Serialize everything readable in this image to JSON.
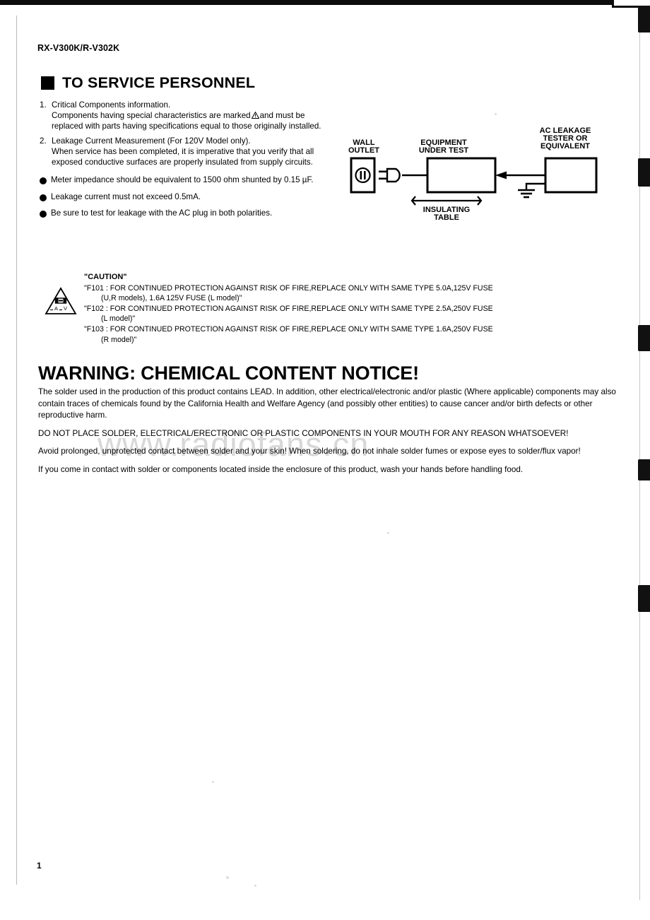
{
  "document": {
    "model_line": "RX-V300K/R-V302K",
    "page_number": "1",
    "watermark": "www.radiofans.cn"
  },
  "service_section": {
    "heading": "TO SERVICE PERSONNEL",
    "numbered_items": [
      {
        "number": "1.",
        "line1": "Critical Components information.",
        "line2_a": "Components having special characteristics are marked",
        "line2_b": "and must be replaced with parts having specifications equal to those originally installed."
      },
      {
        "number": "2.",
        "line1": "Leakage Current Measurement (For 120V Model only).",
        "line2": "When service has been completed, it is imperative that you verify that all exposed conductive surfaces are properly insulated from supply circuits."
      }
    ],
    "bullet_items": [
      "Meter impedance should be equivalent to 1500 ohm shunted by 0.15 µF.",
      "Leakage current must not exceed 0.5mA.",
      "Be sure to test for leakage with the AC plug in both polarities."
    ]
  },
  "diagram": {
    "labels": {
      "wall_outlet_l1": "WALL",
      "wall_outlet_l2": "OUTLET",
      "equipment_l1": "EQUIPMENT",
      "equipment_l2": "UNDER TEST",
      "tester_l1": "AC LEAKAGE",
      "tester_l2": "TESTER OR",
      "tester_l3": "EQUIVALENT",
      "insulating_l1": "INSULATING",
      "insulating_l2": "TABLE"
    }
  },
  "caution": {
    "title": "\"CAUTION\"",
    "fuses": [
      {
        "main": "\"F101 : FOR CONTINUED PROTECTION AGAINST RISK OF FIRE,REPLACE ONLY WITH SAME TYPE 5.0A,125V FUSE",
        "cont": "(U,R models), 1.6A 125V FUSE (L model)\""
      },
      {
        "main": "\"F102 : FOR CONTINUED PROTECTION AGAINST RISK OF FIRE,REPLACE ONLY WITH SAME TYPE 2.5A,250V FUSE",
        "cont": "(L model)\""
      },
      {
        "main": "\"F103 : FOR CONTINUED PROTECTION AGAINST RISK OF FIRE,REPLACE ONLY WITH SAME TYPE 1.6A,250V FUSE",
        "cont": "(R model)\""
      }
    ]
  },
  "warning": {
    "heading": "WARNING: CHEMICAL CONTENT NOTICE!",
    "paragraphs": [
      "The solder used in the production of this product contains LEAD. In addition, other electrical/electronic and/or plastic (Where applicable) components may also contain traces of chemicals found by the California Health and Welfare Agency (and possibly other entities) to cause cancer and/or birth defects or other reproductive harm.",
      "DO NOT PLACE SOLDER, ELECTRICAL/ERECTRONIC OR PLASTIC COMPONENTS IN YOUR MOUTH FOR ANY REASON WHATSOEVER!",
      "Avoid prolonged, unprotected contact between solder and your skin! When soldering, do not inhale solder fumes or expose eyes to solder/flux vapor!",
      "If you come in contact with solder or components located inside the enclosure of this product, wash your hands before handling food."
    ]
  },
  "colors": {
    "ink": "#000000",
    "paper": "#ffffff",
    "watermark": "#d8d8d8"
  }
}
